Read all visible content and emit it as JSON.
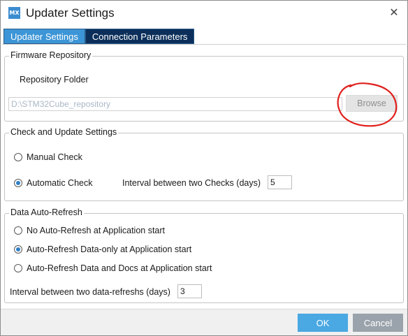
{
  "window": {
    "title": "Updater Settings",
    "app_icon_text": "MX",
    "close_glyph": "✕"
  },
  "tabs": [
    {
      "label": "Updater Settings",
      "active": true
    },
    {
      "label": "Connection Parameters",
      "active": false
    }
  ],
  "firmware": {
    "legend": "Firmware Repository",
    "folder_label": "Repository Folder",
    "folder_value": "D:\\STM32Cube_repository",
    "browse_label": "Browse"
  },
  "check": {
    "legend": "Check and Update Settings",
    "manual_label": "Manual Check",
    "automatic_label": "Automatic Check",
    "selected": "automatic",
    "interval_label": "Interval between two Checks (days)",
    "interval_value": "5"
  },
  "refresh": {
    "legend": "Data Auto-Refresh",
    "options": [
      {
        "label": "No Auto-Refresh at Application start",
        "checked": false
      },
      {
        "label": "Auto-Refresh Data-only at Application start",
        "checked": true
      },
      {
        "label": "Auto-Refresh Data and Docs at Application start",
        "checked": false
      }
    ],
    "interval_label": "Interval between two data-refreshs (days)",
    "interval_value": "3"
  },
  "footer": {
    "ok_label": "OK",
    "cancel_label": "Cancel"
  },
  "colors": {
    "tab_active": "#3c95d6",
    "tab_inactive": "#0b2f5a",
    "ok_button": "#4aa8e2",
    "cancel_button": "#9aa3ab",
    "annotation": "#e0201c"
  }
}
